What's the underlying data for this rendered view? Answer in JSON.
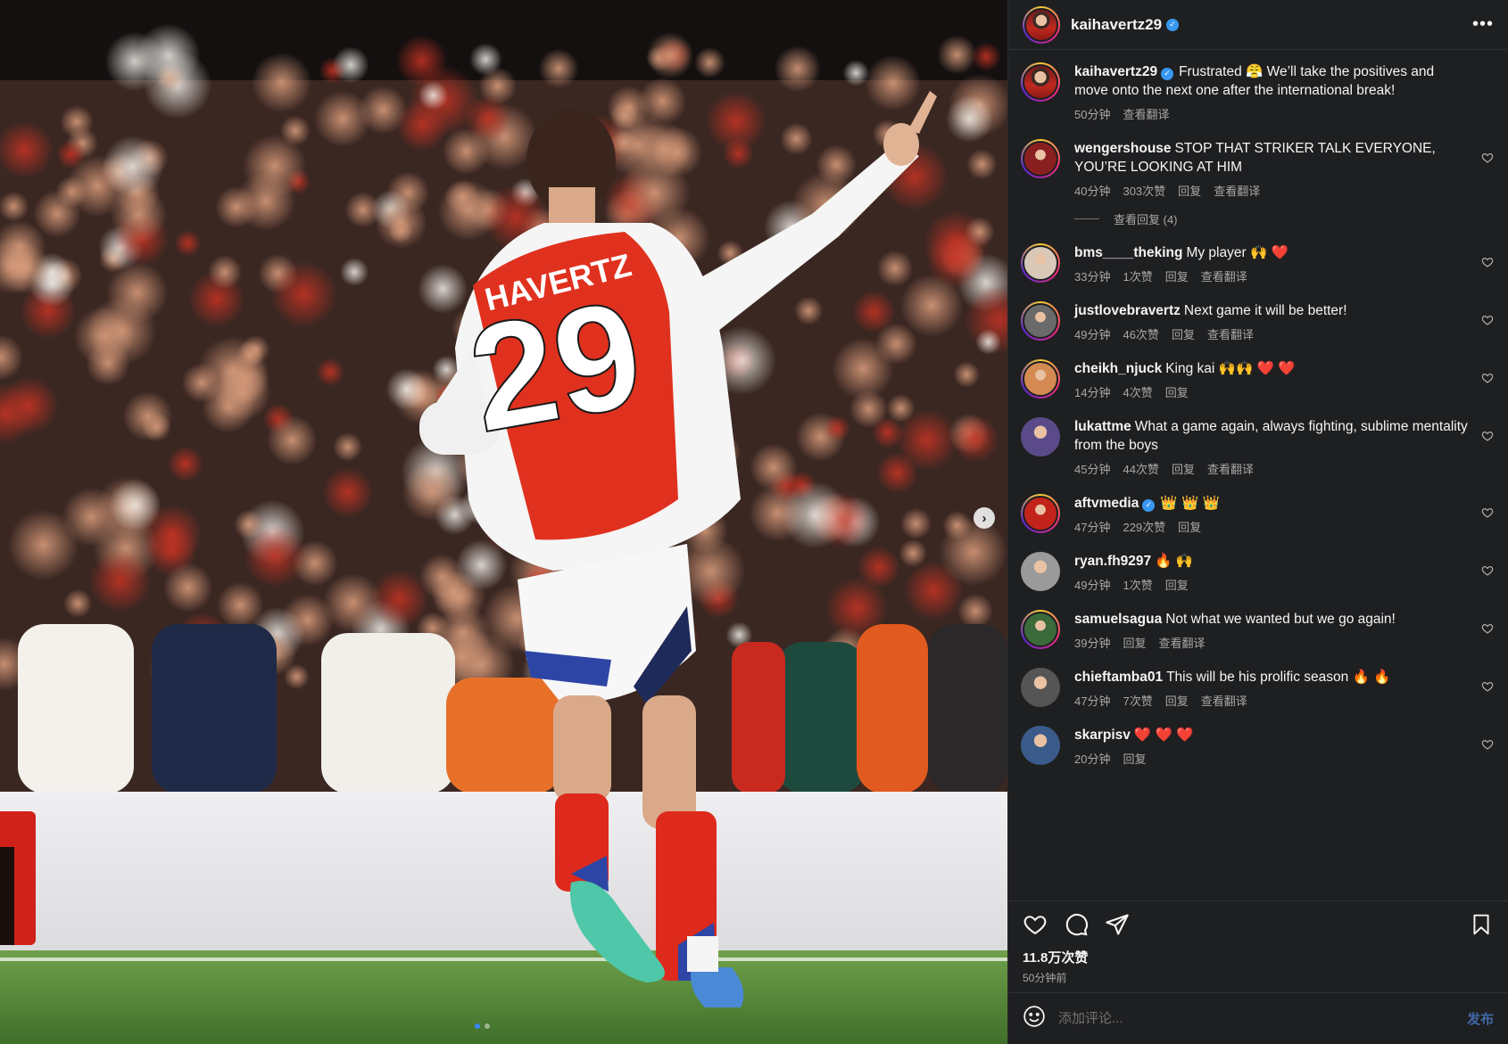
{
  "post": {
    "username": "kaihavertz29",
    "verified": true,
    "caption": "Frustrated 😤 We’ll take the positives and move onto the next one after the international break!",
    "caption_time": "50分钟",
    "caption_translate": "查看翻译"
  },
  "comments": [
    {
      "user": "wengershouse",
      "text": "STOP THAT STRIKER TALK EVERYONE, YOU’RE LOOKING AT HIM",
      "time": "40分钟",
      "likes": "303次赞",
      "reply": "回复",
      "translate": "查看翻译",
      "view_replies": "查看回复 (4)"
    },
    {
      "user": "bms____theking",
      "text": "My player 🙌 ❤️",
      "time": "33分钟",
      "likes": "1次赞",
      "reply": "回复",
      "translate": "查看翻译"
    },
    {
      "user": "justlovebravertz",
      "text": "Next game it will be better!",
      "time": "49分钟",
      "likes": "46次赞",
      "reply": "回复",
      "translate": "查看翻译"
    },
    {
      "user": "cheikh_njuck",
      "text": "King kai 🙌🙌 ❤️ ❤️",
      "time": "14分钟",
      "likes": "4次赞",
      "reply": "回复",
      "translate": ""
    },
    {
      "user": "lukattme",
      "text": "What a game again, always fighting, sublime mentality from the boys",
      "time": "45分钟",
      "likes": "44次赞",
      "reply": "回复",
      "translate": "查看翻译"
    },
    {
      "user": "aftvmedia",
      "text": "👑 👑 👑",
      "time": "47分钟",
      "likes": "229次赞",
      "reply": "回复",
      "translate": "",
      "verified": true
    },
    {
      "user": "ryan.fh9297",
      "text": "🔥 🙌",
      "time": "49分钟",
      "likes": "1次赞",
      "reply": "回复",
      "translate": ""
    },
    {
      "user": "samuelsagua",
      "text": "Not what we wanted but we go again!",
      "time": "39分钟",
      "likes": "",
      "reply": "回复",
      "translate": "查看翻译"
    },
    {
      "user": "chieftamba01",
      "text": "This will be his prolific season 🔥 🔥",
      "time": "47分钟",
      "likes": "7次赞",
      "reply": "回复",
      "translate": "查看翻译"
    },
    {
      "user": "skarpisv",
      "text": "❤️ ❤️ ❤️",
      "time": "20分钟",
      "likes": "",
      "reply": "回复",
      "translate": ""
    }
  ],
  "actions": {
    "likes_count": "11.8万次赞",
    "posted_ago": "50分钟前"
  },
  "input": {
    "placeholder": "添加评论...",
    "post_label": "发布"
  },
  "media": {
    "jersey_name": "HAVERTZ",
    "jersey_number": "29",
    "slide_count": 2,
    "active_slide": 1
  },
  "icons": {
    "like": "heart-icon",
    "comment": "comment-icon",
    "share": "send-icon",
    "save": "bookmark-icon",
    "emoji": "emoji-icon",
    "more": "more-icon",
    "next": "chevron-right-icon"
  },
  "colors": {
    "panel_bg": "#1e1f21",
    "verified": "#3897f0",
    "post_button": "#3f69a8",
    "arsenal_red": "#e0311f"
  }
}
